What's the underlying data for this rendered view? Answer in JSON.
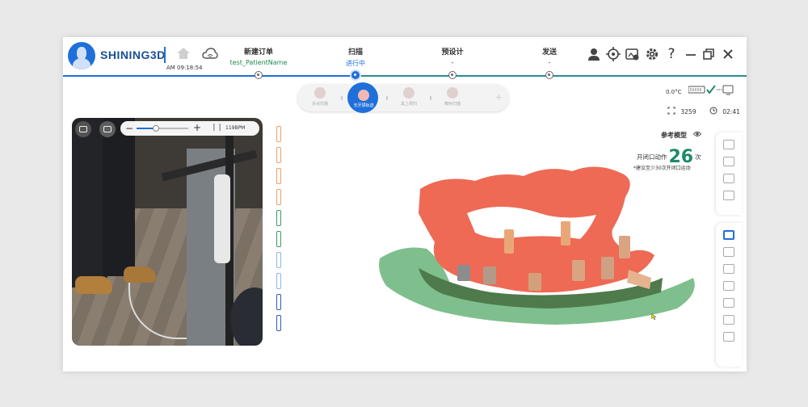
{
  "brand": {
    "name": "SHINING3D"
  },
  "header": {
    "time": "AM 09:18:54",
    "steps": [
      {
        "title": "新建订单",
        "sub": "test_PatientName"
      },
      {
        "title": "扫描",
        "sub": "进行中"
      },
      {
        "title": "预设计",
        "sub": "-"
      },
      {
        "title": "发送",
        "sub": "-"
      }
    ],
    "icons": [
      "user-icon",
      "target-icon",
      "screenshot-icon",
      "gear-icon",
      "help-icon",
      "minimize-icon",
      "restore-icon",
      "close-icon"
    ]
  },
  "toolbar": {
    "tools": [
      {
        "label": "多点扫描",
        "active": false
      },
      {
        "label": "无牙颌轨迹",
        "active": true
      },
      {
        "label": "黑上颌扫",
        "active": false
      },
      {
        "label": "散射扫描",
        "active": false
      }
    ]
  },
  "status": {
    "temperature": "0.0°C",
    "frames": "3259",
    "timer": "02:41"
  },
  "reference": {
    "title": "参考模型",
    "motion_prefix": "开闭口动作",
    "motion_count": "26",
    "motion_suffix": "次",
    "hint": "*建议至少30次开闭口运动"
  },
  "camera": {
    "bpm": "119BPM",
    "slider_value": 0.38
  },
  "colors": {
    "accent": "#1e6fd9",
    "teal": "#1e8a6a",
    "model_red": "#ee6a55",
    "model_green": "#7fbf8e"
  },
  "strips": [
    {
      "color": "#f0a062"
    },
    {
      "color": "#f0a062"
    },
    {
      "color": "#f0a062"
    },
    {
      "color": "#f0a062"
    },
    {
      "color": "#3e9a6a"
    },
    {
      "color": "#3e9a6a"
    },
    {
      "color": "#8fb6e6"
    },
    {
      "color": "#8fb6e6"
    },
    {
      "color": "#2c5fb0"
    },
    {
      "color": "#2c5fb0"
    }
  ]
}
